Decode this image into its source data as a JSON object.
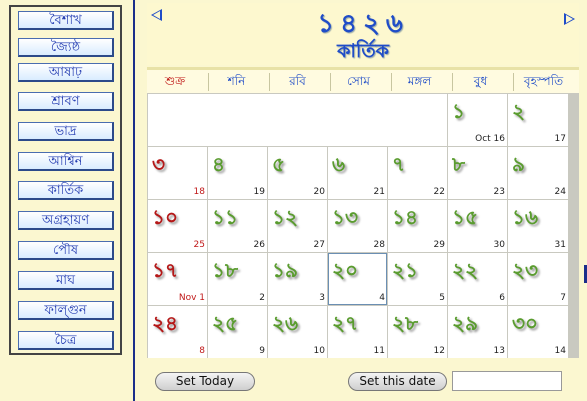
{
  "months": [
    "বৈশাখ",
    "জ্যৈষ্ঠ",
    "আষাঢ়",
    "শ্রাবণ",
    "ভাদ্র",
    "আশ্বিন",
    "কার্তিক",
    "অগ্রহায়ণ",
    "পৌষ",
    "মাঘ",
    "ফাল্গুন",
    "চৈত্র"
  ],
  "header": {
    "year": "১৪২৬",
    "month": "কার্তিক"
  },
  "weekdays": [
    "শুক্র",
    "শনি",
    "রবি",
    "সোম",
    "মঙ্গল",
    "বুধ",
    "বৃহস্পতি"
  ],
  "days": [
    {
      "bn": "১",
      "en": "Oct 16"
    },
    {
      "bn": "২",
      "en": "17"
    },
    {
      "bn": "৩",
      "en": "18"
    },
    {
      "bn": "৪",
      "en": "19"
    },
    {
      "bn": "৫",
      "en": "20"
    },
    {
      "bn": "৬",
      "en": "21"
    },
    {
      "bn": "৭",
      "en": "22"
    },
    {
      "bn": "৮",
      "en": "23"
    },
    {
      "bn": "৯",
      "en": "24"
    },
    {
      "bn": "১০",
      "en": "25"
    },
    {
      "bn": "১১",
      "en": "26"
    },
    {
      "bn": "১২",
      "en": "27"
    },
    {
      "bn": "১৩",
      "en": "28"
    },
    {
      "bn": "১৪",
      "en": "29"
    },
    {
      "bn": "১৫",
      "en": "30"
    },
    {
      "bn": "১৬",
      "en": "31"
    },
    {
      "bn": "১৭",
      "en": "Nov 1"
    },
    {
      "bn": "১৮",
      "en": "2"
    },
    {
      "bn": "১৯",
      "en": "3"
    },
    {
      "bn": "২০",
      "en": "4"
    },
    {
      "bn": "২১",
      "en": "5"
    },
    {
      "bn": "২২",
      "en": "6"
    },
    {
      "bn": "২৩",
      "en": "7"
    },
    {
      "bn": "২৪",
      "en": "8"
    },
    {
      "bn": "২৫",
      "en": "9"
    },
    {
      "bn": "২৬",
      "en": "10"
    },
    {
      "bn": "২৭",
      "en": "11"
    },
    {
      "bn": "২৮",
      "en": "12"
    },
    {
      "bn": "২৯",
      "en": "13"
    },
    {
      "bn": "৩০",
      "en": "14"
    }
  ],
  "buttons": {
    "set_today": "Set Today",
    "set_date": "Set this date"
  },
  "date_input": {
    "value": ""
  },
  "colors": {
    "accent": "#1f4cc8",
    "friday_red": "#b51818",
    "day_green": "#5a9c2f"
  }
}
